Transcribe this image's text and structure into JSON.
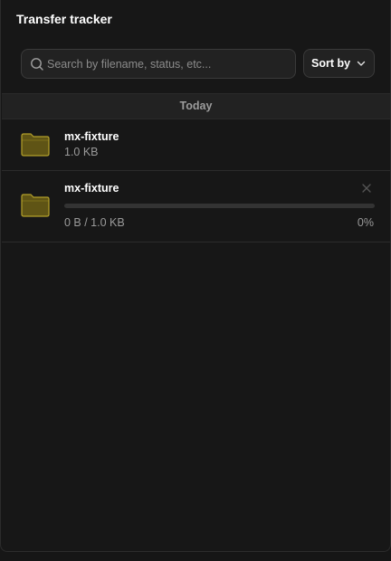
{
  "header": {
    "title": "Transfer tracker"
  },
  "search": {
    "icon": "search-icon",
    "placeholder": "Search by filename, status, etc...",
    "value": ""
  },
  "sort": {
    "label": "Sort by",
    "icon": "chevron-down-icon"
  },
  "section": {
    "label": "Today"
  },
  "transfers": [
    {
      "icon": "folder-icon",
      "name": "mx-fixture",
      "size": "1.0 KB"
    },
    {
      "icon": "folder-icon",
      "name": "mx-fixture",
      "status": "0 B / 1.0 KB",
      "percent_label": "0%",
      "progress": 0,
      "close_icon": "close-icon"
    }
  ],
  "colors": {
    "background": "#171717",
    "folder_fill": "#5f5415",
    "folder_stroke": "#b3a02a",
    "muted_text": "#9a9a9a",
    "progress_track": "#333333"
  }
}
